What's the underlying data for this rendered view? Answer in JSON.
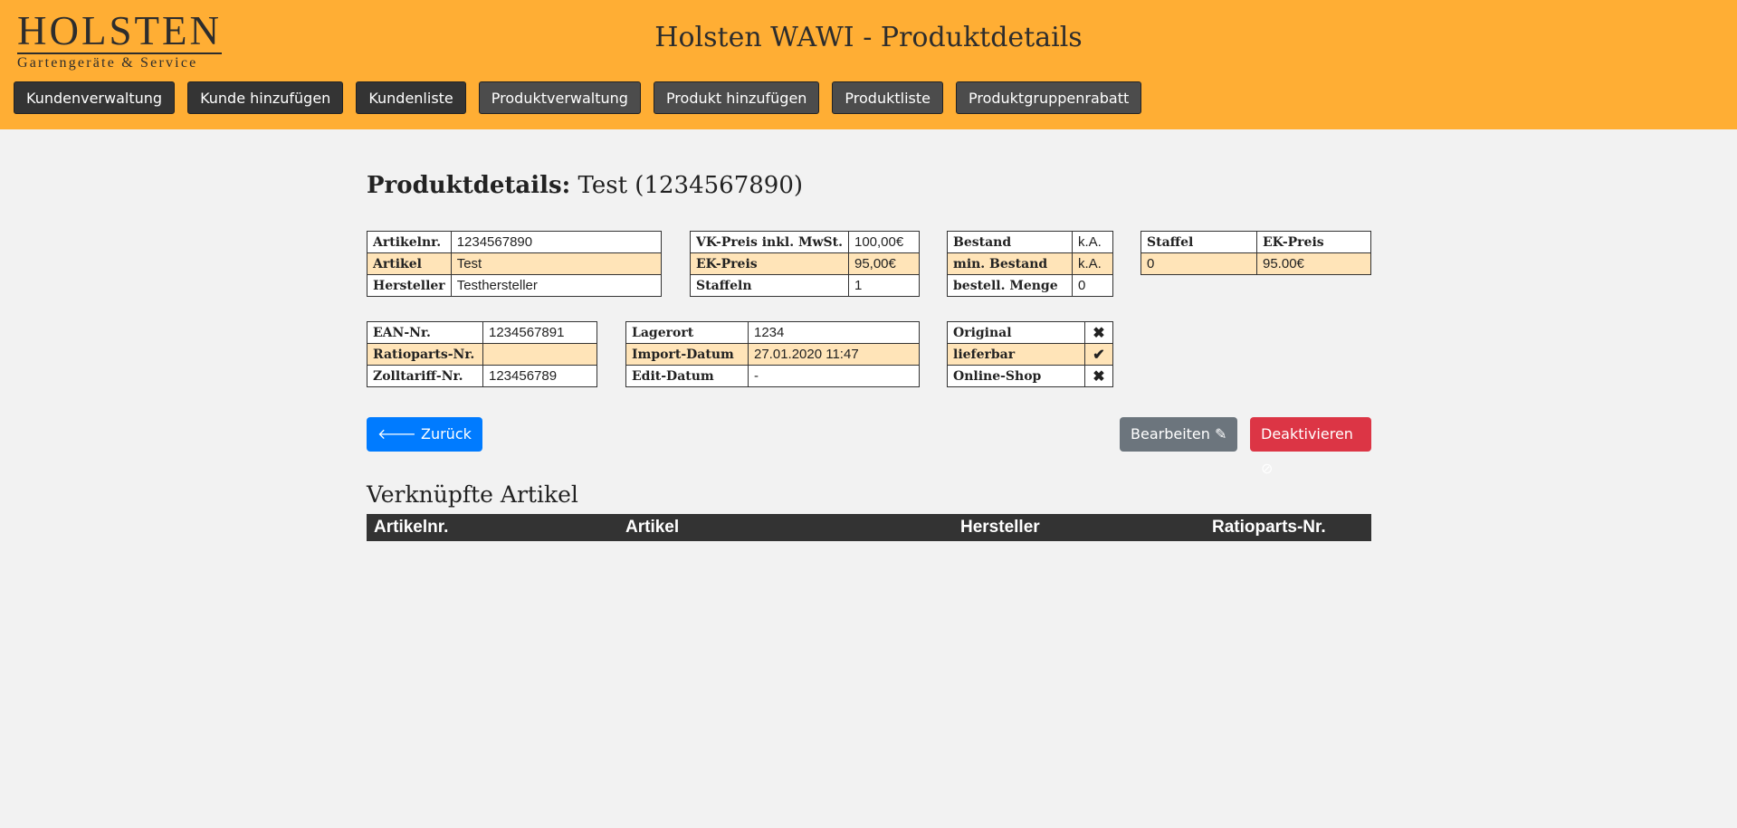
{
  "logo": {
    "brand": "HOLSTEN",
    "sub": "Gartengeräte & Service"
  },
  "app_title": "Holsten WAWI - Produktdetails",
  "nav": [
    {
      "label": "Kundenverwaltung"
    },
    {
      "label": "Kunde hinzufügen"
    },
    {
      "label": "Kundenliste"
    },
    {
      "label": "Produktverwaltung"
    },
    {
      "label": "Produkt hinzufügen"
    },
    {
      "label": "Produktliste"
    },
    {
      "label": "Produktgruppenrabatt"
    }
  ],
  "page_title": {
    "prefix": "Produktdetails:",
    "name": "Test (1234567890)"
  },
  "t1": [
    {
      "k": "Artikelnr.",
      "v": "1234567890"
    },
    {
      "k": "Artikel",
      "v": "Test"
    },
    {
      "k": "Hersteller",
      "v": "Testhersteller"
    }
  ],
  "t2": [
    {
      "k": "VK-Preis inkl. MwSt.",
      "v": "100,00€"
    },
    {
      "k": "EK-Preis",
      "v": "95,00€"
    },
    {
      "k": "Staffeln",
      "v": "1"
    }
  ],
  "t3": [
    {
      "k": "Bestand",
      "v": "k.A."
    },
    {
      "k": "min. Bestand",
      "v": "k.A."
    },
    {
      "k": "bestell. Menge",
      "v": "0"
    }
  ],
  "t4": {
    "headers": [
      "Staffel",
      "EK-Preis"
    ],
    "rows": [
      [
        "0",
        "95.00€"
      ]
    ]
  },
  "t5": [
    {
      "k": "EAN-Nr.",
      "v": "1234567891"
    },
    {
      "k": "Ratioparts-Nr.",
      "v": ""
    },
    {
      "k": "Zolltariff-Nr.",
      "v": "123456789"
    }
  ],
  "t6": [
    {
      "k": "Lagerort",
      "v": "1234"
    },
    {
      "k": "Import-Datum",
      "v": "27.01.2020 11:47"
    },
    {
      "k": "Edit-Datum",
      "v": "-"
    }
  ],
  "t7": [
    {
      "k": "Original",
      "icon": "x-mark-icon",
      "glyph": "✖"
    },
    {
      "k": "lieferbar",
      "icon": "check-icon",
      "glyph": "✔"
    },
    {
      "k": "Online-Shop",
      "icon": "x-mark-icon",
      "glyph": "✖"
    }
  ],
  "buttons": {
    "back": "Zurück",
    "edit": "Bearbeiten",
    "deactivate": "Deaktivieren"
  },
  "linked": {
    "title": "Verknüpfte Artikel",
    "headers": [
      "Artikelnr.",
      "Artikel",
      "Hersteller",
      "Ratioparts-Nr."
    ]
  },
  "colors": {
    "header": "#ffae34",
    "row_alt": "#ffe4b8",
    "primary": "#007bff",
    "secondary": "#6c757d",
    "danger": "#dc3545"
  }
}
